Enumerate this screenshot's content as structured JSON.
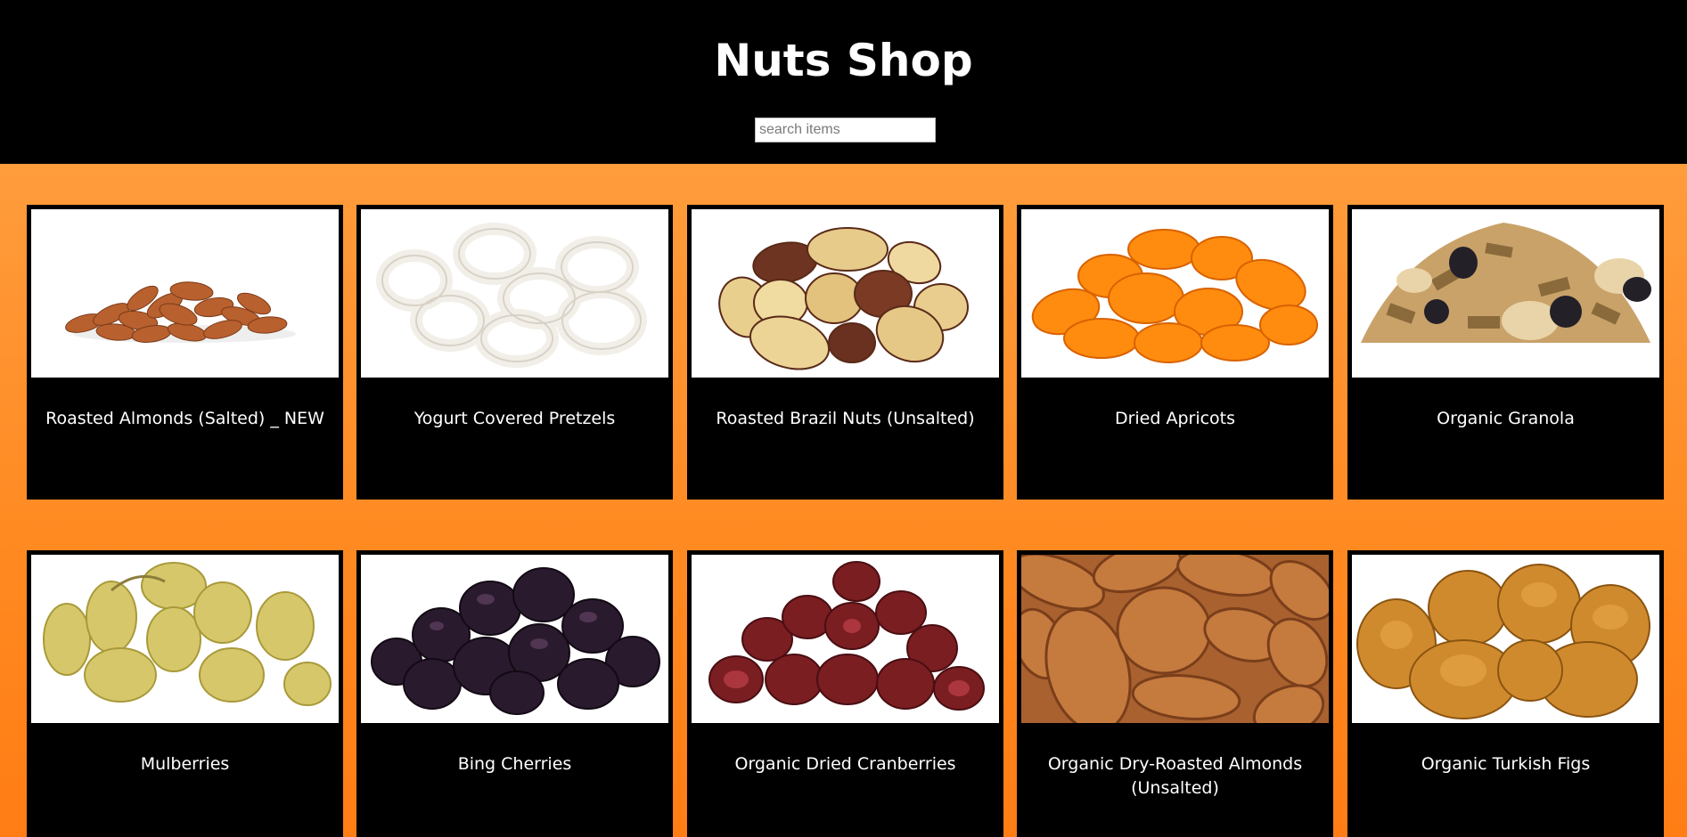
{
  "header": {
    "title": "Nuts Shop",
    "search_placeholder": "search items"
  },
  "products": [
    {
      "name": "Roasted Almonds (Salted) _ NEW",
      "icon": "almonds-image"
    },
    {
      "name": "Yogurt Covered Pretzels",
      "icon": "pretzels-image"
    },
    {
      "name": "Roasted Brazil Nuts (Unsalted)",
      "icon": "brazil-nuts-image"
    },
    {
      "name": "Dried Apricots",
      "icon": "apricots-image"
    },
    {
      "name": "Organic Granola",
      "icon": "granola-image"
    },
    {
      "name": "Mulberries",
      "icon": "mulberries-image"
    },
    {
      "name": "Bing Cherries",
      "icon": "cherries-image"
    },
    {
      "name": "Organic Dried Cranberries",
      "icon": "cranberries-image"
    },
    {
      "name": "Organic Dry-Roasted Almonds (Unsalted)",
      "icon": "almonds-closeup-image"
    },
    {
      "name": "Organic Turkish Figs",
      "icon": "figs-image"
    }
  ],
  "colors": {
    "header_bg": "#000000",
    "page_bg_top": "#ff9c3c",
    "page_bg_bottom": "#ff7d14",
    "card_bg": "#000000",
    "text": "#ffffff"
  }
}
